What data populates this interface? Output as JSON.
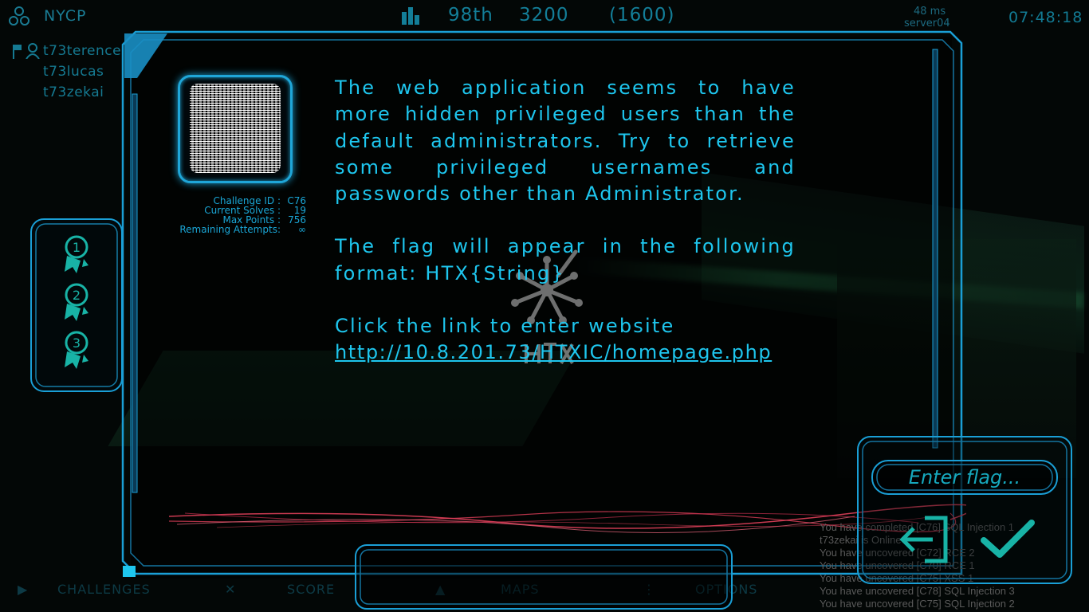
{
  "hud": {
    "team_name": "NYCP",
    "rank": "98th",
    "score": "3200",
    "score_sub": "(1600)",
    "ping": "48 ms",
    "server": "server04",
    "clock": "07:48:18"
  },
  "members": [
    "t73terence",
    "t73lucas",
    "t73zekai"
  ],
  "challenge": {
    "meta": [
      {
        "label": "Challenge ID :",
        "value": "C76"
      },
      {
        "label": "Current Solves :",
        "value": "19"
      },
      {
        "label": "Max Points   :",
        "value": "756"
      },
      {
        "label": "Remaining Attempts:",
        "value": "∞"
      }
    ],
    "description_1": "The web application seems to have more hidden privileged users than the default administrators. Try to retrieve some privileged usernames and passwords other than Administrator.",
    "description_2": "The flag will appear in the following format: HTX{String}",
    "description_3": "Click the link to enter website",
    "link": "http://10.8.201.73/HTXIC/homepage.php"
  },
  "badges": [
    "1",
    "2",
    "3"
  ],
  "flag_input": {
    "placeholder": "Enter flag..."
  },
  "nav": [
    {
      "label": "CHALLENGES",
      "icon": "play-icon"
    },
    {
      "label": "SCORE",
      "icon": "close-icon"
    },
    {
      "label": "MAPS",
      "icon": "triangle-icon"
    },
    {
      "label": "OPTIONS",
      "icon": "dots-icon"
    }
  ],
  "log": [
    "You have completed [C76] SQL Injection 1",
    "t73zekai is Online",
    "You have uncovered [C72] RCE 2",
    "You have uncovered [C70] RCE 1",
    "You have uncovered [C75] XSS 1",
    "You have uncovered [C78] SQL Injection 3",
    "You have uncovered [C75] SQL Injection 2"
  ],
  "colors": {
    "accent": "#1ec6ee",
    "frame": "#1a9fd6",
    "laser": "#e0405a",
    "submit": "#18b3a6"
  }
}
